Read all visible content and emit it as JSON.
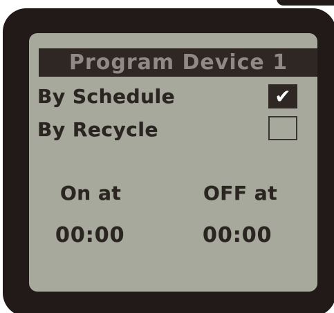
{
  "title": "Program Device 1",
  "options": [
    {
      "label": "By Schedule",
      "checked": true
    },
    {
      "label": "By Recycle",
      "checked": false
    }
  ],
  "check_symbol": "✔",
  "on": {
    "label": "On at",
    "time": "00:00"
  },
  "off": {
    "label": "OFF at",
    "time": "00:00"
  },
  "colors": {
    "bezel": "#221a19",
    "screen": "#a7a99d",
    "ink": "#2b2521",
    "title_bar": "#2e2723",
    "title_text": "#8f8b84"
  }
}
